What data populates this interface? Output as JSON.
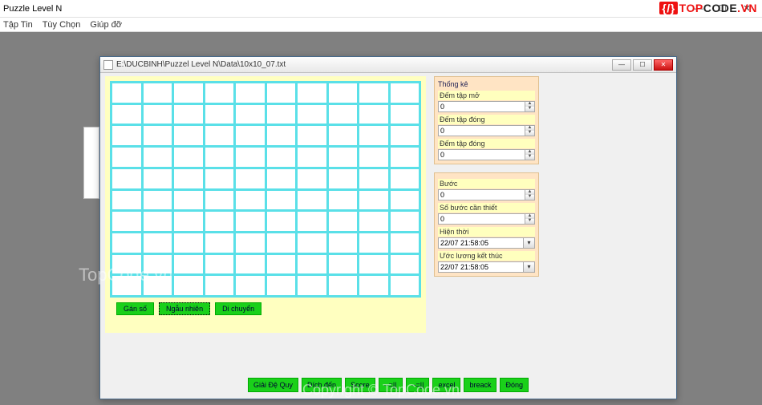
{
  "outer": {
    "title": "Puzzle Level N",
    "menu": [
      "Tập Tin",
      "Tùy Chọn",
      "Giúp đỡ"
    ],
    "win_min": "—",
    "win_max": "☐",
    "win_close": "✕"
  },
  "brand": {
    "brace": "{/}",
    "t1": "TOP",
    "t2": "CODE",
    "t3": ".VN"
  },
  "watermark1": "TopCode.vn",
  "watermark2": "Copyright © TopCode.vn",
  "child": {
    "title": "E:\\DUCBINH\\Puzzel Level N\\Data\\10x10_07.txt",
    "grid": {
      "rows": 10,
      "cols": 10
    },
    "grid_buttons": {
      "gan_so": "Gán số",
      "ngau_nhien": "Ngẫu nhiên",
      "di_chuyen": "Di chuyển"
    },
    "stats1": {
      "title": "Thống kê",
      "open_label": "Đếm tập mở",
      "open_val": "0",
      "close_label": "Đếm tập đóng",
      "close_val": "0",
      "close2_label": "Đếm tập đóng",
      "close2_val": "0"
    },
    "stats2": {
      "step_label": "Bước",
      "step_val": "0",
      "needed_label": "Số bước cần thiết",
      "needed_val": "0",
      "now_label": "Hiện thời",
      "now_val": "22/07 21:58:05",
      "eta_label": "Ước lương kết thúc",
      "eta_val": "22/07 21:58:05"
    },
    "bottom_buttons": [
      "Giải Đệ Quy",
      "Đích đến",
      "Score",
      "--=||",
      "--=||",
      "excel",
      "breack",
      "Đóng"
    ]
  }
}
